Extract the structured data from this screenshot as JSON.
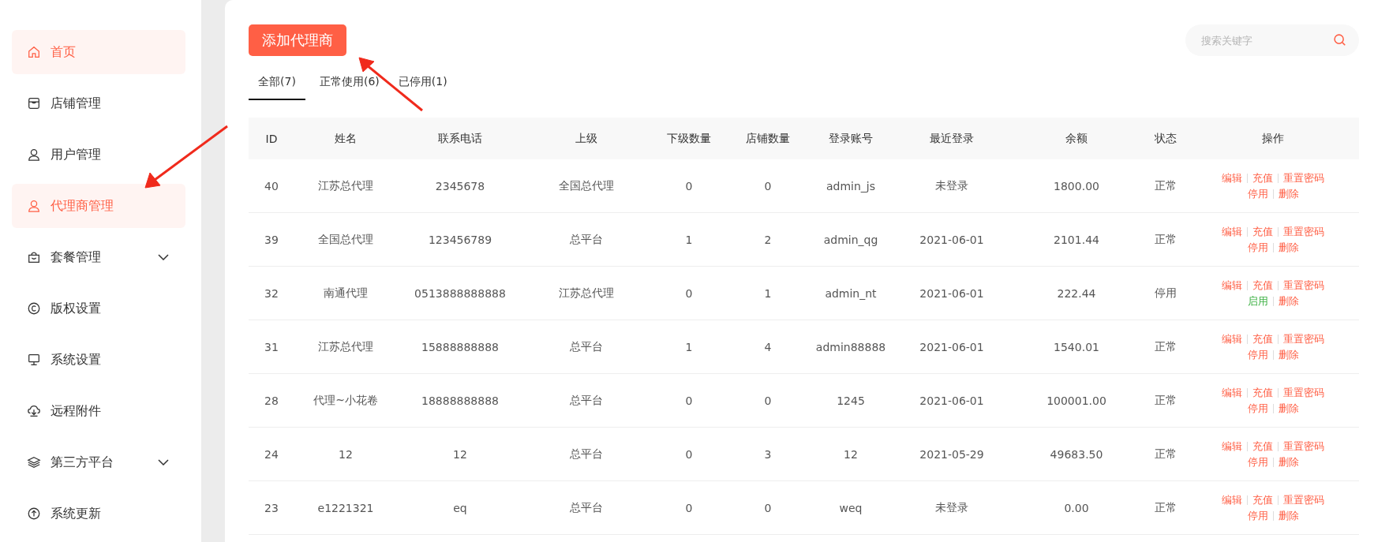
{
  "sidebar": {
    "items": [
      {
        "label": "首页",
        "selected": true
      },
      {
        "label": "店铺管理",
        "selected": false
      },
      {
        "label": "用户管理",
        "selected": false
      },
      {
        "label": "代理商管理",
        "selected": true
      },
      {
        "label": "套餐管理",
        "selected": false,
        "expanded": false
      },
      {
        "label": "版权设置",
        "selected": false
      },
      {
        "label": "系统设置",
        "selected": false
      },
      {
        "label": "远程附件",
        "selected": false
      },
      {
        "label": "第三方平台",
        "selected": false,
        "expanded": false
      },
      {
        "label": "系统更新",
        "selected": false
      }
    ]
  },
  "toolbar": {
    "add_button": "添加代理商",
    "search": {
      "placeholder": "搜索关键字"
    }
  },
  "tabs": [
    {
      "label": "全部(7)",
      "selected": true
    },
    {
      "label": "正常使用(6)",
      "selected": false
    },
    {
      "label": "已停用(1)",
      "selected": false
    }
  ],
  "table": {
    "columns": [
      "ID",
      "姓名",
      "联系电话",
      "上级",
      "下级数量",
      "店铺数量",
      "登录账号",
      "最近登录",
      "余额",
      "状态",
      "操作"
    ],
    "rows": [
      {
        "cells": [
          "40",
          "江苏总代理",
          "2345678",
          "全国总代理",
          "0",
          "0",
          "admin_js",
          "未登录",
          "1800.00",
          "正常"
        ],
        "actions": [
          {
            "label": "编辑",
            "kind": "edit"
          },
          {
            "label": "充值",
            "kind": "recharge"
          },
          {
            "label": "重置密码",
            "kind": "reset"
          },
          {
            "label": "停用",
            "kind": "disable"
          },
          {
            "label": "删除",
            "kind": "delete"
          }
        ]
      },
      {
        "cells": [
          "39",
          "全国总代理",
          "123456789",
          "总平台",
          "1",
          "2",
          "admin_qg",
          "2021-06-01",
          "2101.44",
          "正常"
        ],
        "actions": [
          {
            "label": "编辑",
            "kind": "edit"
          },
          {
            "label": "充值",
            "kind": "recharge"
          },
          {
            "label": "重置密码",
            "kind": "reset"
          },
          {
            "label": "停用",
            "kind": "disable"
          },
          {
            "label": "删除",
            "kind": "delete"
          }
        ]
      },
      {
        "cells": [
          "32",
          "南通代理",
          "0513888888888",
          "江苏总代理",
          "0",
          "1",
          "admin_nt",
          "2021-06-01",
          "222.44",
          "停用"
        ],
        "actions": [
          {
            "label": "编辑",
            "kind": "edit"
          },
          {
            "label": "充值",
            "kind": "recharge"
          },
          {
            "label": "重置密码",
            "kind": "reset"
          },
          {
            "label": "启用",
            "kind": "enable"
          },
          {
            "label": "删除",
            "kind": "delete"
          }
        ]
      },
      {
        "cells": [
          "31",
          "江苏总代理",
          "15888888888",
          "总平台",
          "1",
          "4",
          "admin88888",
          "2021-06-01",
          "1540.01",
          "正常"
        ],
        "actions": [
          {
            "label": "编辑",
            "kind": "edit"
          },
          {
            "label": "充值",
            "kind": "recharge"
          },
          {
            "label": "重置密码",
            "kind": "reset"
          },
          {
            "label": "停用",
            "kind": "disable"
          },
          {
            "label": "删除",
            "kind": "delete"
          }
        ]
      },
      {
        "cells": [
          "28",
          "代理~小花卷",
          "18888888888",
          "总平台",
          "0",
          "0",
          "1245",
          "2021-06-01",
          "100001.00",
          "正常"
        ],
        "actions": [
          {
            "label": "编辑",
            "kind": "edit"
          },
          {
            "label": "充值",
            "kind": "recharge"
          },
          {
            "label": "重置密码",
            "kind": "reset"
          },
          {
            "label": "停用",
            "kind": "disable"
          },
          {
            "label": "删除",
            "kind": "delete"
          }
        ]
      },
      {
        "cells": [
          "24",
          "12",
          "12",
          "总平台",
          "0",
          "3",
          "12",
          "2021-05-29",
          "49683.50",
          "正常"
        ],
        "actions": [
          {
            "label": "编辑",
            "kind": "edit"
          },
          {
            "label": "充值",
            "kind": "recharge"
          },
          {
            "label": "重置密码",
            "kind": "reset"
          },
          {
            "label": "停用",
            "kind": "disable"
          },
          {
            "label": "删除",
            "kind": "delete"
          }
        ]
      },
      {
        "cells": [
          "23",
          "e1221321",
          "eq",
          "总平台",
          "0",
          "0",
          "weq",
          "未登录",
          "0.00",
          "正常"
        ],
        "actions": [
          {
            "label": "编辑",
            "kind": "edit"
          },
          {
            "label": "充值",
            "kind": "recharge"
          },
          {
            "label": "重置密码",
            "kind": "reset"
          },
          {
            "label": "停用",
            "kind": "disable"
          },
          {
            "label": "删除",
            "kind": "delete"
          }
        ]
      }
    ]
  }
}
